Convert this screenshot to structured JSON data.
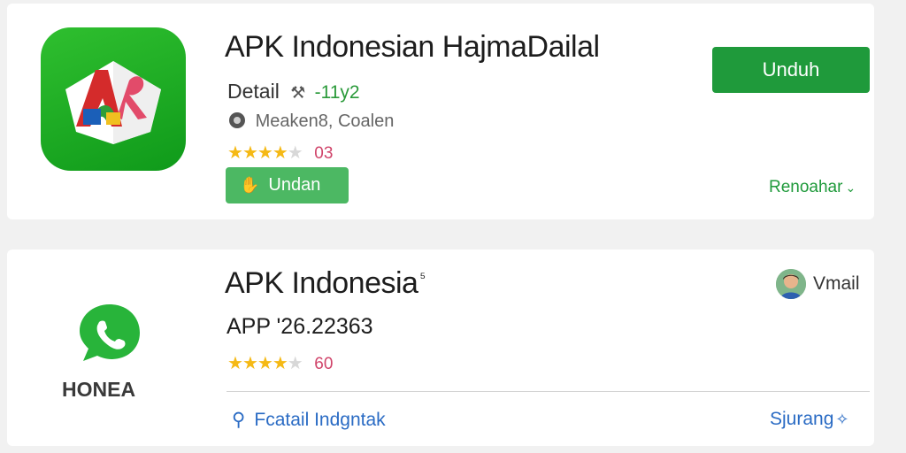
{
  "card1": {
    "title": "APK Indonesian HajmaDailal",
    "detail_label": "Detail",
    "detail_icon": "wrench-icon",
    "version": "-11y2",
    "developer": "Meaken8, Coalen",
    "rating_count": "03",
    "rating_stars": 4,
    "download_button": "Unduh",
    "secondary_button": "Undan",
    "more_link": "Renoahar",
    "accent_color": "#1f9a3b"
  },
  "card2": {
    "title": "APK Indonesia",
    "title_sup": "⁵",
    "version": "APP ʹ26.22363",
    "rating_count": "60",
    "rating_stars": 4,
    "brand_text": "HONEA",
    "user_label": "Vmail",
    "search_text": "Fcatail Indgntak",
    "link_text": "Sjurang",
    "link_color": "#2a6bc4"
  }
}
